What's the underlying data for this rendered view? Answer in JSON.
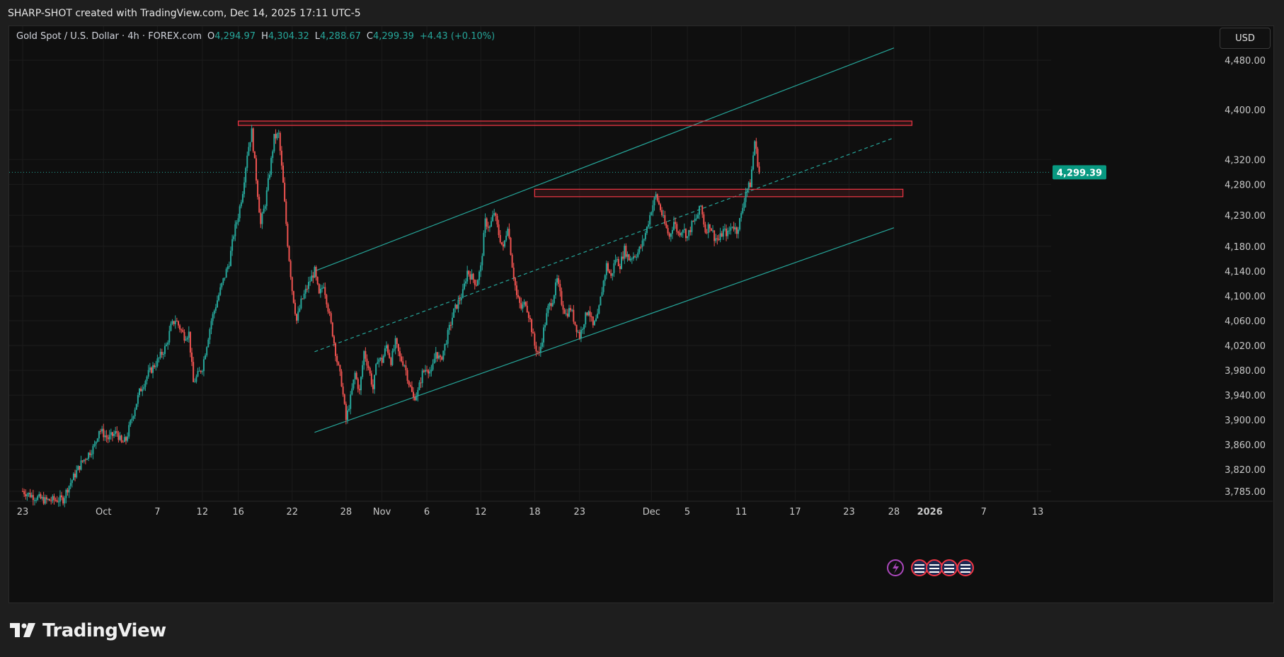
{
  "header": {
    "title": "SHARP-SHOT created with TradingView.com, Dec 14, 2025 17:11 UTC-5"
  },
  "legend": {
    "symbol": "Gold Spot / U.S. Dollar · 4h · FOREX.com",
    "open_label": "O",
    "open": "4,294.97",
    "high_label": "H",
    "high": "4,304.32",
    "low_label": "L",
    "low": "4,288.67",
    "close_label": "C",
    "close": "4,299.39",
    "change": "+4.43 (+0.10%)"
  },
  "currency_button": "USD",
  "last_price_label": "4,299.39",
  "footer": {
    "brand": "TradingView"
  },
  "colors": {
    "up": "#26a69a",
    "down": "#ef5350",
    "channel": "#26a69a",
    "zone": "#f23645",
    "background": "#0f0f0f",
    "price_label_bg": "#089981",
    "event_icon": "#ab47bc"
  },
  "chart_data": {
    "type": "candlestick",
    "timeframe": "4h",
    "y_ticks": [
      4480,
      4400,
      4320,
      4280,
      4230,
      4180,
      4140,
      4100,
      4060,
      4020,
      3980,
      3940,
      3900,
      3860,
      3820,
      3785
    ],
    "y_tick_labels": [
      "4,480.00",
      "4,400.00",
      "4,320.00",
      "4,280.00",
      "4,230.00",
      "4,180.00",
      "4,140.00",
      "4,100.00",
      "4,060.00",
      "4,020.00",
      "3,980.00",
      "3,940.00",
      "3,900.00",
      "3,860.00",
      "3,820.00",
      "3,785.00"
    ],
    "ylim": [
      3770,
      4535
    ],
    "x_ticks": [
      {
        "day": -8,
        "label": "23",
        "bold": false
      },
      {
        "day": 1,
        "label": "Oct",
        "bold": false
      },
      {
        "day": 7,
        "label": "7",
        "bold": false
      },
      {
        "day": 12,
        "label": "12",
        "bold": false
      },
      {
        "day": 16,
        "label": "16",
        "bold": false
      },
      {
        "day": 22,
        "label": "22",
        "bold": false
      },
      {
        "day": 28,
        "label": "28",
        "bold": false
      },
      {
        "day": 32,
        "label": "Nov",
        "bold": false
      },
      {
        "day": 37,
        "label": "6",
        "bold": false
      },
      {
        "day": 43,
        "label": "12",
        "bold": false
      },
      {
        "day": 49,
        "label": "18",
        "bold": false
      },
      {
        "day": 54,
        "label": "23",
        "bold": false
      },
      {
        "day": 62,
        "label": "Dec",
        "bold": false
      },
      {
        "day": 66,
        "label": "5",
        "bold": false
      },
      {
        "day": 72,
        "label": "11",
        "bold": false
      },
      {
        "day": 78,
        "label": "17",
        "bold": false
      },
      {
        "day": 84,
        "label": "23",
        "bold": false
      },
      {
        "day": 89,
        "label": "28",
        "bold": false
      },
      {
        "day": 93,
        "label": "2026",
        "bold": true
      },
      {
        "day": 99,
        "label": "7",
        "bold": false
      },
      {
        "day": 105,
        "label": "13",
        "bold": false
      }
    ],
    "price_path": [
      [
        -8.0,
        3785
      ],
      [
        -7.0,
        3778
      ],
      [
        -5.5,
        3770
      ],
      [
        -3.5,
        3772
      ],
      [
        -3.0,
        3790
      ],
      [
        -1.5,
        3830
      ],
      [
        0.0,
        3858
      ],
      [
        0.5,
        3885
      ],
      [
        1.5,
        3870
      ],
      [
        2.5,
        3880
      ],
      [
        3.0,
        3862
      ],
      [
        3.5,
        3868
      ],
      [
        4.0,
        3895
      ],
      [
        5.0,
        3945
      ],
      [
        6.0,
        3975
      ],
      [
        7.0,
        3995
      ],
      [
        8.0,
        4020
      ],
      [
        8.5,
        4050
      ],
      [
        9.0,
        4062
      ],
      [
        10.0,
        4035
      ],
      [
        10.5,
        4040
      ],
      [
        11.0,
        3960
      ],
      [
        12.0,
        3985
      ],
      [
        13.0,
        4060
      ],
      [
        14.0,
        4110
      ],
      [
        15.0,
        4155
      ],
      [
        15.5,
        4200
      ],
      [
        16.0,
        4230
      ],
      [
        16.5,
        4270
      ],
      [
        17.0,
        4330
      ],
      [
        17.5,
        4365
      ],
      [
        18.0,
        4290
      ],
      [
        18.5,
        4215
      ],
      [
        19.0,
        4250
      ],
      [
        19.5,
        4300
      ],
      [
        20.0,
        4355
      ],
      [
        20.5,
        4360
      ],
      [
        21.0,
        4280
      ],
      [
        21.5,
        4185
      ],
      [
        22.0,
        4110
      ],
      [
        22.5,
        4060
      ],
      [
        23.0,
        4090
      ],
      [
        24.0,
        4125
      ],
      [
        24.5,
        4140
      ],
      [
        25.0,
        4100
      ],
      [
        25.5,
        4120
      ],
      [
        26.0,
        4080
      ],
      [
        26.5,
        4040
      ],
      [
        27.0,
        3995
      ],
      [
        27.5,
        3960
      ],
      [
        28.0,
        3900
      ],
      [
        28.5,
        3935
      ],
      [
        29.0,
        3975
      ],
      [
        29.5,
        3945
      ],
      [
        30.0,
        4010
      ],
      [
        30.5,
        3985
      ],
      [
        31.0,
        3950
      ],
      [
        31.5,
        4000
      ],
      [
        32.0,
        3995
      ],
      [
        32.5,
        4020
      ],
      [
        33.0,
        3995
      ],
      [
        33.5,
        4025
      ],
      [
        34.0,
        4000
      ],
      [
        34.5,
        3990
      ],
      [
        35.0,
        3960
      ],
      [
        35.5,
        3935
      ],
      [
        36.0,
        3945
      ],
      [
        36.5,
        3975
      ],
      [
        37.0,
        3985
      ],
      [
        37.5,
        3975
      ],
      [
        38.0,
        4010
      ],
      [
        38.5,
        3995
      ],
      [
        39.0,
        4020
      ],
      [
        40.0,
        4075
      ],
      [
        41.0,
        4105
      ],
      [
        41.5,
        4140
      ],
      [
        42.0,
        4130
      ],
      [
        42.5,
        4120
      ],
      [
        43.0,
        4145
      ],
      [
        43.5,
        4220
      ],
      [
        44.0,
        4210
      ],
      [
        44.5,
        4235
      ],
      [
        45.0,
        4200
      ],
      [
        45.5,
        4175
      ],
      [
        46.0,
        4215
      ],
      [
        46.5,
        4150
      ],
      [
        47.0,
        4100
      ],
      [
        47.5,
        4080
      ],
      [
        48.0,
        4090
      ],
      [
        48.5,
        4060
      ],
      [
        49.0,
        4020
      ],
      [
        49.5,
        4005
      ],
      [
        50.0,
        4045
      ],
      [
        50.5,
        4080
      ],
      [
        51.0,
        4095
      ],
      [
        51.5,
        4125
      ],
      [
        52.0,
        4090
      ],
      [
        52.5,
        4070
      ],
      [
        53.0,
        4080
      ],
      [
        53.5,
        4055
      ],
      [
        54.0,
        4035
      ],
      [
        54.5,
        4060
      ],
      [
        55.0,
        4080
      ],
      [
        55.5,
        4050
      ],
      [
        56.0,
        4065
      ],
      [
        56.5,
        4110
      ],
      [
        57.0,
        4150
      ],
      [
        57.5,
        4130
      ],
      [
        58.0,
        4160
      ],
      [
        58.5,
        4150
      ],
      [
        59.0,
        4175
      ],
      [
        59.5,
        4160
      ],
      [
        60.0,
        4165
      ],
      [
        60.5,
        4170
      ],
      [
        61.0,
        4185
      ],
      [
        61.5,
        4210
      ],
      [
        62.0,
        4240
      ],
      [
        62.5,
        4262
      ],
      [
        63.0,
        4240
      ],
      [
        63.5,
        4215
      ],
      [
        64.0,
        4195
      ],
      [
        64.5,
        4220
      ],
      [
        65.0,
        4200
      ],
      [
        65.5,
        4210
      ],
      [
        66.0,
        4195
      ],
      [
        66.5,
        4215
      ],
      [
        67.0,
        4225
      ],
      [
        67.5,
        4245
      ],
      [
        68.0,
        4205
      ],
      [
        68.5,
        4215
      ],
      [
        69.0,
        4195
      ],
      [
        69.5,
        4190
      ],
      [
        70.0,
        4205
      ],
      [
        70.5,
        4200
      ],
      [
        71.0,
        4215
      ],
      [
        71.5,
        4205
      ],
      [
        72.0,
        4230
      ],
      [
        72.5,
        4270
      ],
      [
        73.0,
        4280
      ],
      [
        73.5,
        4350
      ],
      [
        74.0,
        4298
      ]
    ],
    "annotations": [
      {
        "type": "ascending_channel",
        "upper": [
          [
            24.5,
            4140
          ],
          [
            89,
            4500
          ]
        ],
        "lower": [
          [
            24.5,
            3880
          ],
          [
            89,
            4210
          ]
        ],
        "midline": [
          [
            24.5,
            4010
          ],
          [
            89,
            4355
          ]
        ]
      },
      {
        "type": "resistance_zone",
        "x0": 16,
        "x1": 91,
        "y0": 4375,
        "y1": 4382
      },
      {
        "type": "support_zone",
        "x0": 49,
        "x1": 90,
        "y0": 4260,
        "y1": 4272
      }
    ],
    "last_price": 4299.39,
    "grid": true
  }
}
